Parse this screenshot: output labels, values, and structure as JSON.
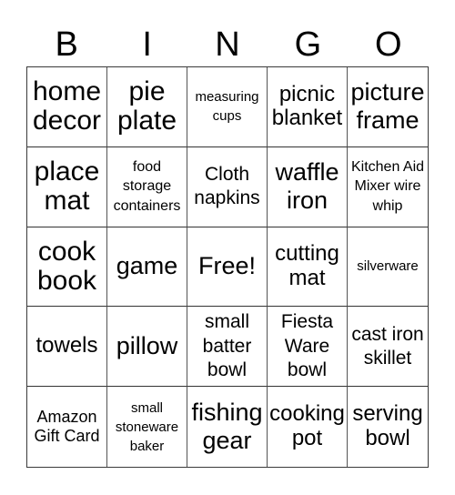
{
  "header": [
    "B",
    "I",
    "N",
    "G",
    "O"
  ],
  "cells": [
    {
      "text": "home decor",
      "size": "s-xl"
    },
    {
      "text": "pie plate",
      "size": "s-xl"
    },
    {
      "text": "measuring cups",
      "size": "s-xxs"
    },
    {
      "text": "picnic blanket",
      "size": "s-m"
    },
    {
      "text": "picture frame",
      "size": "s-l"
    },
    {
      "text": "place mat",
      "size": "s-xl"
    },
    {
      "text": "food storage containers",
      "size": "s-xs"
    },
    {
      "text": "Cloth napkins",
      "size": "s-ms"
    },
    {
      "text": "waffle iron",
      "size": "s-l"
    },
    {
      "text": "Kitchen Aid Mixer wire whip",
      "size": "s-xs"
    },
    {
      "text": "cook book",
      "size": "s-xl"
    },
    {
      "text": "game",
      "size": "s-l"
    },
    {
      "text": "Free!",
      "size": "s-l"
    },
    {
      "text": "cutting mat",
      "size": "s-m"
    },
    {
      "text": "silverware",
      "size": "s-xxs"
    },
    {
      "text": "towels",
      "size": "s-m"
    },
    {
      "text": "pillow",
      "size": "s-l"
    },
    {
      "text": "small batter bowl",
      "size": "s-ms"
    },
    {
      "text": "Fiesta Ware bowl",
      "size": "s-ms"
    },
    {
      "text": "cast iron skillet",
      "size": "s-ms"
    },
    {
      "text": "Amazon Gift Card",
      "size": "s-s"
    },
    {
      "text": "small stoneware baker",
      "size": "s-xxs"
    },
    {
      "text": "fishing gear",
      "size": "s-l"
    },
    {
      "text": "cooking pot",
      "size": "s-m"
    },
    {
      "text": "serving bowl",
      "size": "s-m"
    }
  ]
}
